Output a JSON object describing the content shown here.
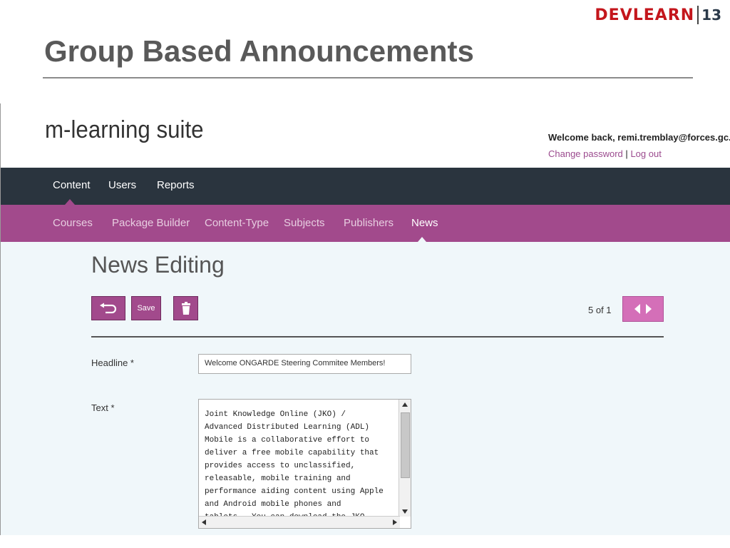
{
  "slide": {
    "title": "Group Based Announcements",
    "logo": {
      "word": "DEVLEARN",
      "number": "13"
    }
  },
  "app": {
    "brand": "m-learning suite",
    "welcome": "Welcome back, remi.tremblay@forces.gc.ca",
    "change_password": "Change password",
    "logout": "Log out",
    "separator": "|"
  },
  "nav_top": [
    "Content",
    "Users",
    "Reports"
  ],
  "nav_sub": [
    "Courses",
    "Package Builder",
    "Content-Type",
    "Subjects",
    "Publishers",
    "News"
  ],
  "nav_active": {
    "top": "Content",
    "sub": "News"
  },
  "page": {
    "heading": "News Editing",
    "save_label": "Save",
    "pager_text": "5 of 1"
  },
  "form": {
    "headline_label": "Headline *",
    "headline_value": "Welcome ONGARDE Steering Commitee Members!",
    "text_label": "Text *",
    "text_value": "Joint Knowledge Online (JKO) /\nAdvanced Distributed Learning (ADL)\nMobile is a collaborative effort to\ndeliver a free mobile capability that\nprovides access to unclassified,\nreleasable, mobile training and\nperformance aiding content using Apple\nand Android mobile phones and\ntablets.  You can download the JKO"
  },
  "colors": {
    "nav_dark": "#2a343e",
    "nav_accent": "#a24a8c",
    "content_bg": "#f0f7fa",
    "pager": "#d46fb8"
  },
  "icons": [
    "devlearn-logo-icon",
    "undo-icon",
    "trash-icon",
    "chevron-left-icon",
    "chevron-right-icon"
  ]
}
